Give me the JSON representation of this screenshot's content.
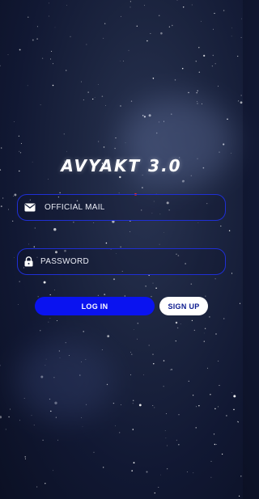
{
  "app": {
    "title": "AVYAKT 3.0"
  },
  "form": {
    "email": {
      "placeholder": "OFFICIAL MAIL",
      "icon": "mail-icon"
    },
    "password": {
      "placeholder": "PASSWORD",
      "icon": "lock-icon"
    },
    "login_label": "LOG IN",
    "signup_label": "SIGN UP"
  },
  "colors": {
    "field_border": "#1f2fd6",
    "login_bg": "#0a13f0",
    "signup_bg": "#ffffff",
    "signup_text": "#0b1a8f"
  }
}
